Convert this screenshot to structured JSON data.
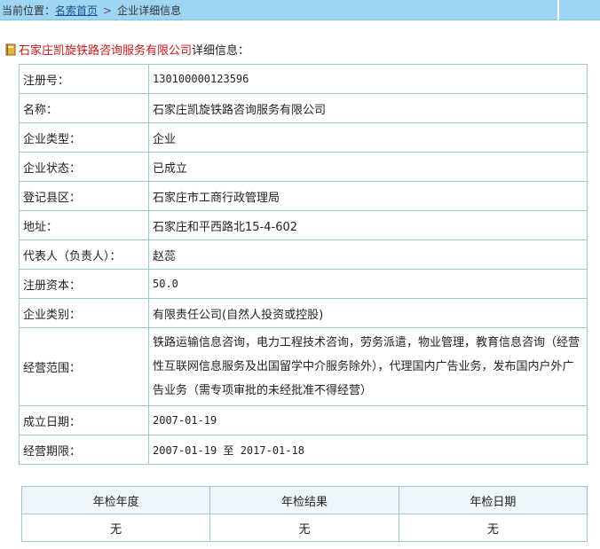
{
  "breadcrumb": {
    "prefix": "当前位置：",
    "home": "名索首页",
    "separator": ">",
    "current": "企业详细信息"
  },
  "heading": {
    "company": "石家庄凯旋铁路咨询服务有限公司",
    "suffix": "详细信息："
  },
  "details": [
    {
      "label": "注册号：",
      "value": "130100000123596"
    },
    {
      "label": "名称：",
      "value": "石家庄凯旋铁路咨询服务有限公司"
    },
    {
      "label": "企业类型：",
      "value": "企业"
    },
    {
      "label": "企业状态：",
      "value": "已成立"
    },
    {
      "label": "登记县区：",
      "value": "石家庄市工商行政管理局"
    },
    {
      "label": "地址：",
      "value": "石家庄和平西路北15-4-602"
    },
    {
      "label": "代表人（负责人）：",
      "value": "赵蕊"
    },
    {
      "label": "注册资本：",
      "value": "50.0"
    },
    {
      "label": "企业类别：",
      "value": "有限责任公司(自然人投资或控股)"
    },
    {
      "label": "经营范围：",
      "value": "铁路运输信息咨询，电力工程技术咨询，劳务派遣，物业管理，教育信息咨询（经营性互联网信息服务及出国留学中介服务除外），代理国内广告业务，发布国内户外广告业务（需专项审批的未经批准不得经营）"
    },
    {
      "label": "成立日期：",
      "value": "2007-01-19"
    },
    {
      "label": "经营期限：",
      "value": "2007-01-19 至 2017-01-18"
    }
  ],
  "annual_check": {
    "headers": [
      "年检年度",
      "年检结果",
      "年检日期"
    ],
    "row": [
      "无",
      "无",
      "无"
    ]
  },
  "colors": {
    "topbar": "#9ed5f3",
    "company_name": "#c21a1a",
    "link": "#1c4f8f",
    "table_border": "#9cc6dd"
  }
}
